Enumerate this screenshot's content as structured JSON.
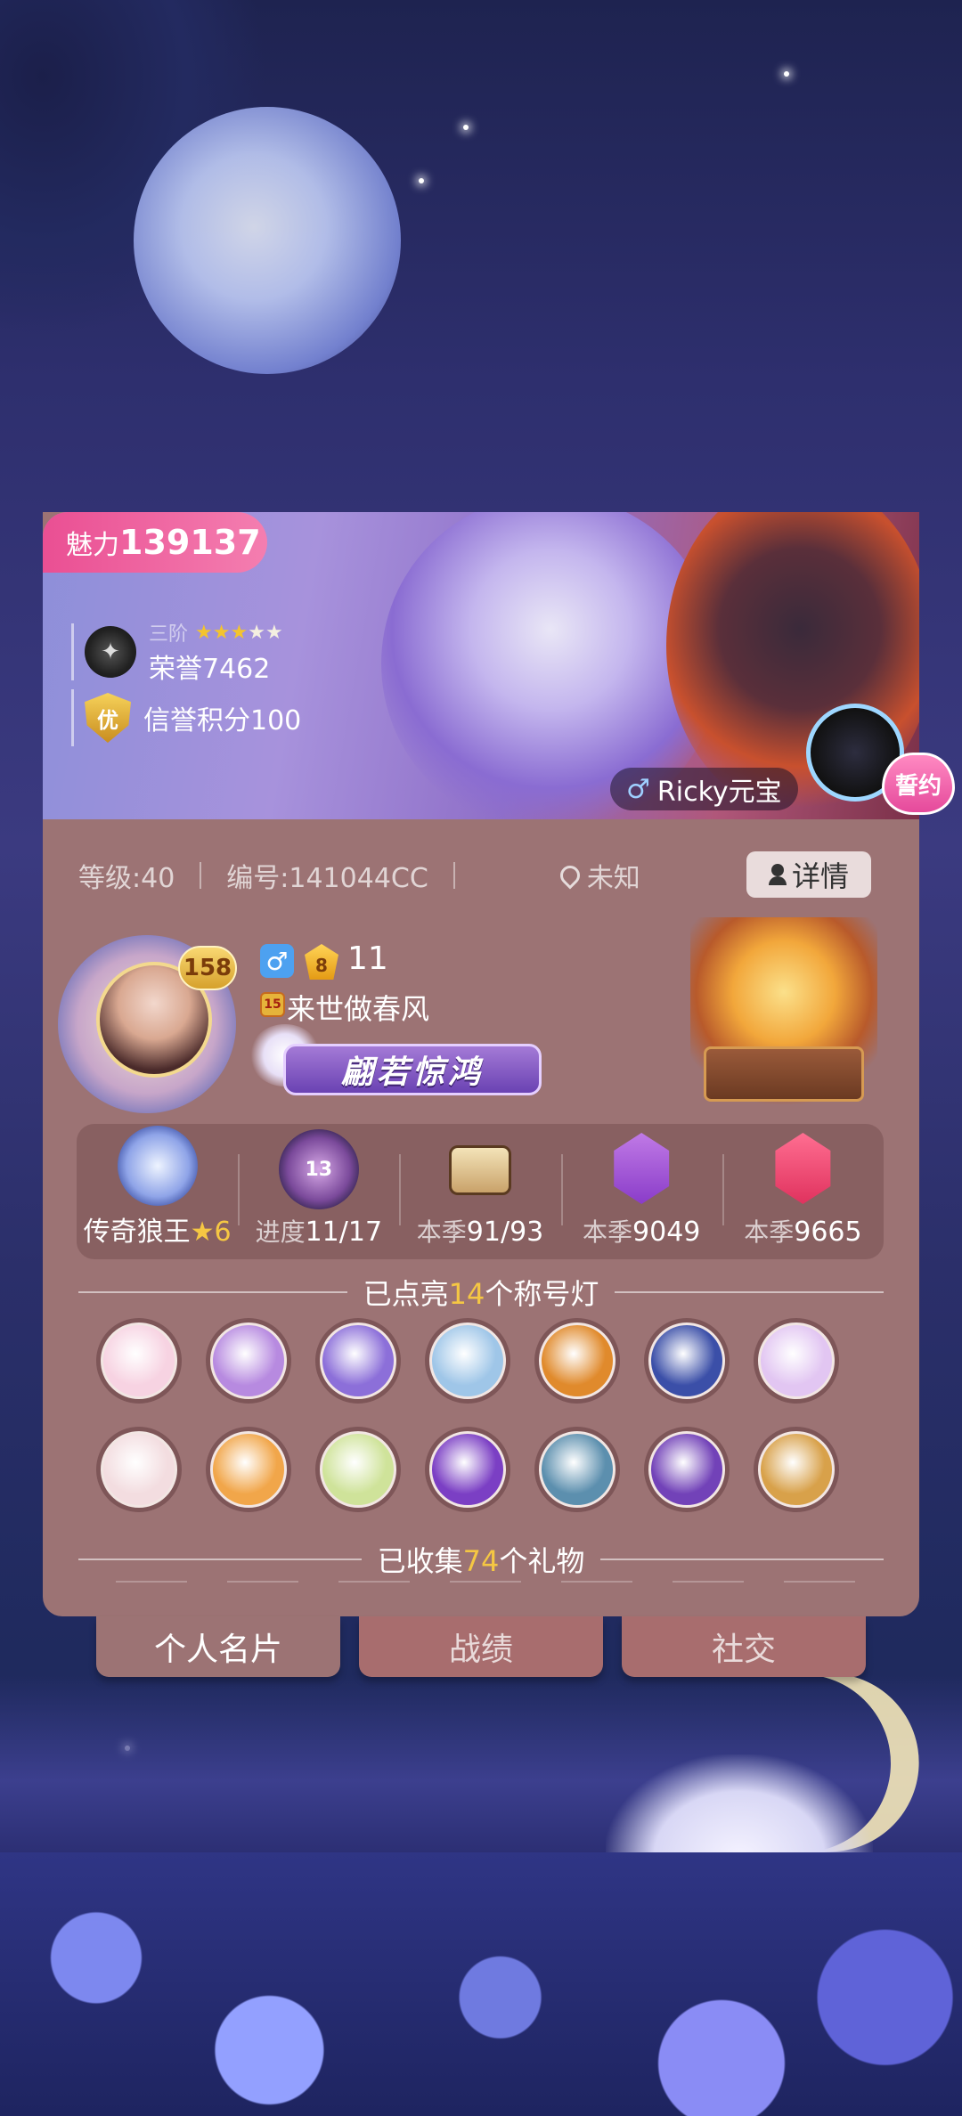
{
  "profile": {
    "charm_label": "魅力",
    "charm_value": "139137",
    "rank_tier": "三阶",
    "honor": "荣誉7462",
    "credit_badge": "优",
    "credit": "信誉积分100",
    "partner_gender": "♂",
    "partner_name": "Ricky元宝",
    "vow_badge": "誓约"
  },
  "stats": {
    "level": "等级:40",
    "id": "编号:141044CC",
    "location": "未知",
    "detail_button": "详情"
  },
  "user": {
    "avatar_level": "158",
    "gender": "♂",
    "vip_level": "8",
    "level_num": "11",
    "clock_badge": "15",
    "nickname": "来世做春风",
    "title_plate": "翩若惊鸿"
  },
  "achievements": [
    {
      "icon": "wolf-king-icon",
      "label": "传奇狼王",
      "star": "★",
      "extra": "6"
    },
    {
      "icon": "progress-emblem-icon",
      "badge": "13",
      "label": "进度",
      "value": "11/17"
    },
    {
      "icon": "camera-icon",
      "label": "本季",
      "value": "91/93"
    },
    {
      "icon": "rose-hex-icon",
      "label": "本季",
      "value": "9049"
    },
    {
      "icon": "sunglasses-hex-icon",
      "label": "本季",
      "value": "9665"
    }
  ],
  "titles_header": {
    "prefix": "已点亮",
    "count": "14",
    "suffix": "个称号灯"
  },
  "title_badges": [
    {
      "icon": "ribbon-medal-icon",
      "color": "#f7d3e2"
    },
    {
      "icon": "crystal-icon",
      "color": "#b78ae0"
    },
    {
      "icon": "white-crane-icon",
      "color": "#8c6fd9"
    },
    {
      "icon": "rubber-duck-icon",
      "color": "#9fc6e8"
    },
    {
      "icon": "golden-dragon-icon",
      "color": "#e08a2c"
    },
    {
      "icon": "love-letter-icon",
      "color": "#3b4fa8"
    },
    {
      "icon": "planet-icon",
      "color": "#e2c6f2"
    },
    {
      "icon": "white-rose-icon",
      "color": "#f3dde0"
    },
    {
      "icon": "heart-trophy-icon",
      "color": "#f1a64a"
    },
    {
      "icon": "lemon-icon",
      "color": "#cfe39a"
    },
    {
      "icon": "black-cat-icon",
      "color": "#7b3fc4"
    },
    {
      "icon": "sword-icon",
      "color": "#5c8fae"
    },
    {
      "icon": "purple-shield-icon",
      "color": "#7242b8"
    },
    {
      "icon": "werewolf-icon",
      "color": "#d8a14a"
    }
  ],
  "gifts_header": {
    "prefix": "已收集",
    "count": "74",
    "suffix": "个礼物"
  },
  "tabs": [
    {
      "label": "个人名片"
    },
    {
      "label": "战绩"
    },
    {
      "label": "社交"
    }
  ]
}
